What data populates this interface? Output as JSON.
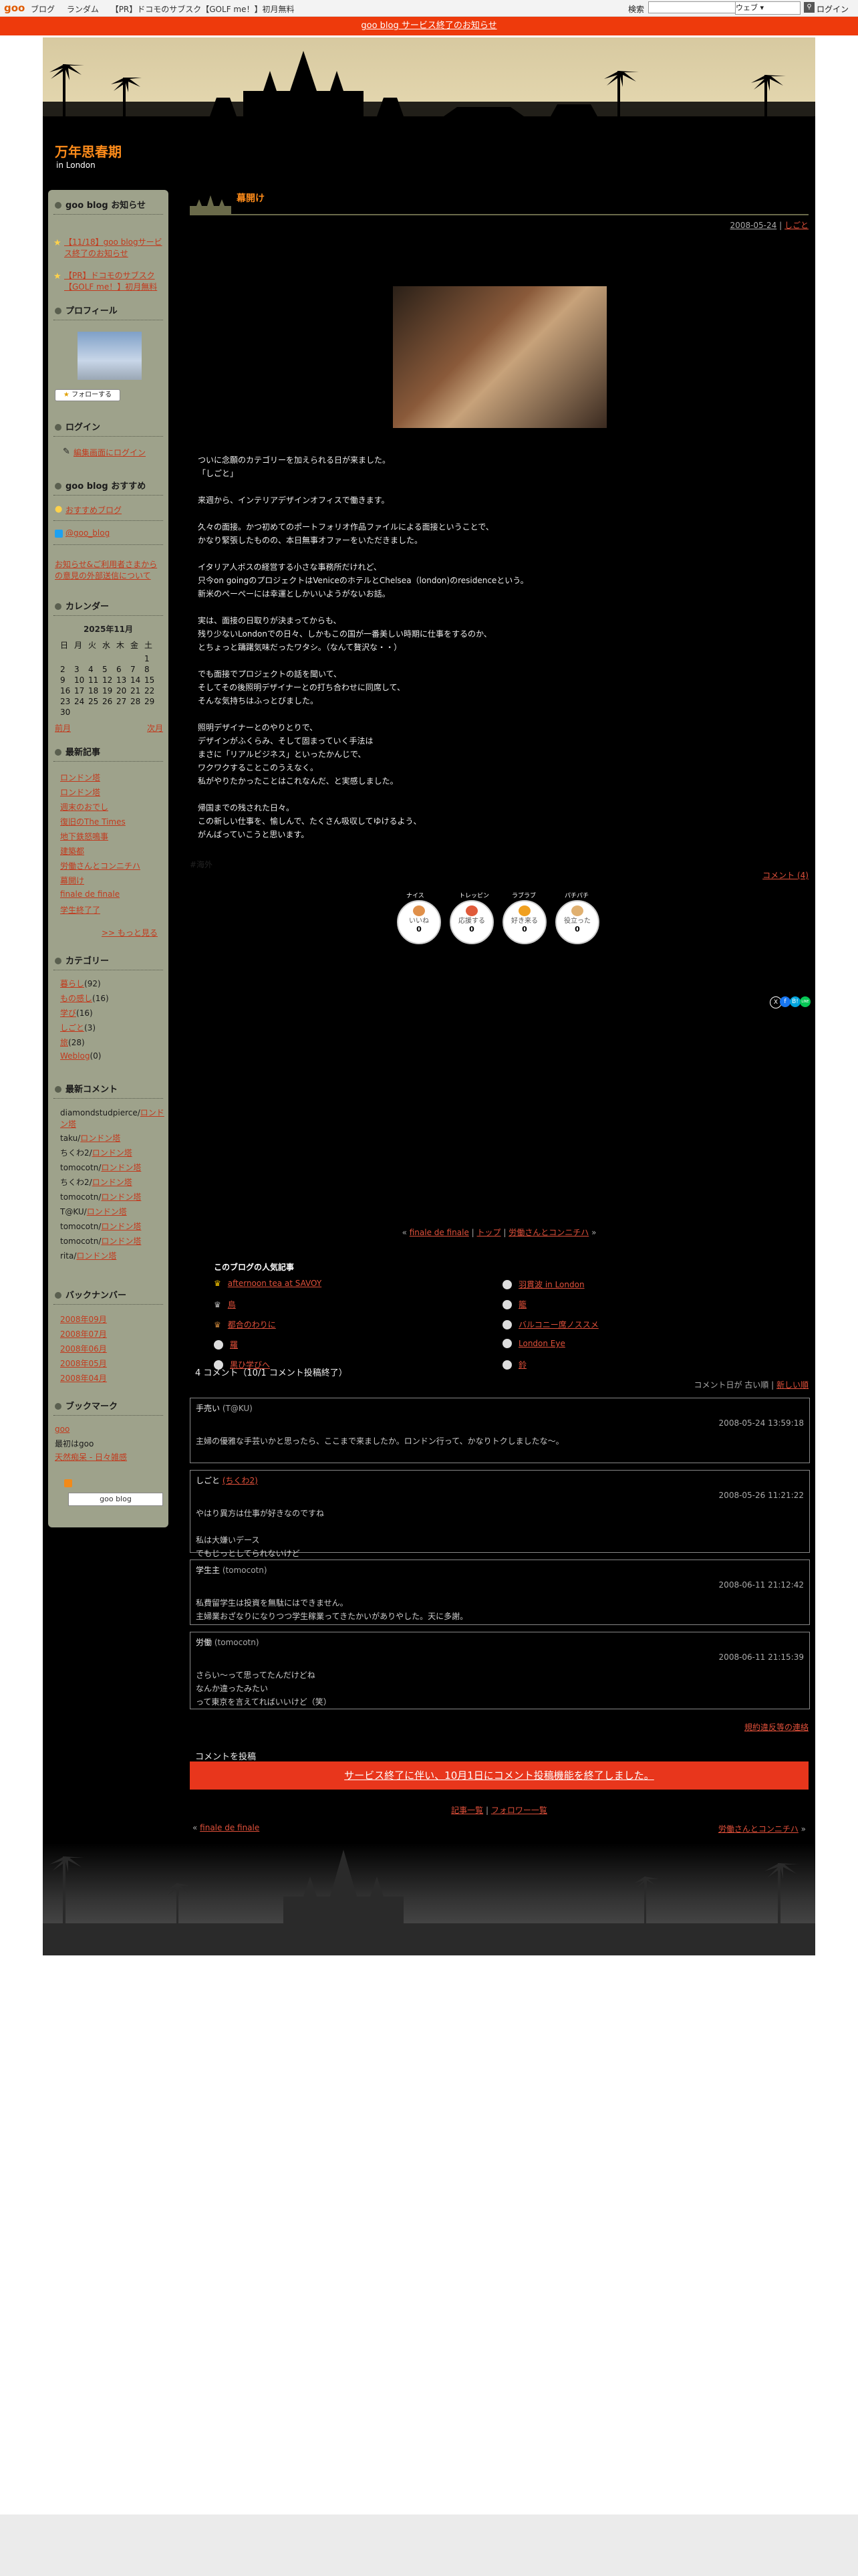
{
  "topbar": {
    "logo": "goo",
    "nav": [
      "ブログ",
      "ランダム",
      "【PR】ドコモのサブスク【GOLF me！】初月無料"
    ],
    "search_label": "検索",
    "search_value": "",
    "search_scope": "ウェブ",
    "login": "ログイン"
  },
  "notice": "goo blog サービス終了のお知らせ",
  "blog": {
    "title": "万年思春期",
    "subtitle": "in London"
  },
  "sidebar": {
    "notice_heading": "goo blog お知らせ",
    "notices": [
      "【11/18】goo blogサービス終了のお知らせ",
      "【PR】ドコモのサブスク【GOLF me！】初月無料"
    ],
    "profile_heading": "プロフィール",
    "follow_label": "フォローする",
    "login_heading": "ログイン",
    "login_link": "編集画面にログイン",
    "recommend_heading": "goo blog おすすめ",
    "recommend_link": "おすすめブログ",
    "twitter_link": "@goo_blog",
    "policy_link": "お知らせ&ご利用者さまからの意見の外部送信について",
    "calendar_heading": "カレンダー",
    "calendar_month": "2025年11月",
    "calendar_weekdays": [
      "日",
      "月",
      "火",
      "水",
      "木",
      "金",
      "土"
    ],
    "calendar_rows": [
      [
        "",
        "",
        "",
        "",
        "",
        "",
        "1"
      ],
      [
        "2",
        "3",
        "4",
        "5",
        "6",
        "7",
        "8"
      ],
      [
        "9",
        "10",
        "11",
        "12",
        "13",
        "14",
        "15"
      ],
      [
        "16",
        "17",
        "18",
        "19",
        "20",
        "21",
        "22"
      ],
      [
        "23",
        "24",
        "25",
        "26",
        "27",
        "28",
        "29"
      ],
      [
        "30",
        "",
        "",
        "",
        "",
        "",
        ""
      ]
    ],
    "prev_month": "前月",
    "next_month": "次月",
    "recent_heading": "最新記事",
    "recent_posts": [
      "ロンドン塔",
      "ロンドン塔",
      "週末のおでし",
      "復旧のThe Times",
      "地下鉄怒鳴事",
      "建築都",
      "労働さんとコンニチハ",
      "幕開け",
      "finale de finale",
      "学生終了了"
    ],
    "more_link": ">> もっと見る",
    "category_heading": "カテゴリー",
    "categories": [
      {
        "name": "暮らし",
        "count": "(92)"
      },
      {
        "name": "もの感し",
        "count": "(16)"
      },
      {
        "name": "学び",
        "count": "(16)"
      },
      {
        "name": "しごと",
        "count": "(3)"
      },
      {
        "name": "旅",
        "count": "(28)"
      },
      {
        "name": "Weblog",
        "count": "(0)"
      }
    ],
    "comments_heading": "最新コメント",
    "comments": [
      {
        "who": "diamondstudpierce/",
        "link": "ロンドン塔"
      },
      {
        "who": "taku/",
        "link": "ロンドン塔"
      },
      {
        "who": "ちくわ2/",
        "link": "ロンドン塔"
      },
      {
        "who": "tomocotn/",
        "link": "ロンドン塔"
      },
      {
        "who": "ちくわ2/",
        "link": "ロンドン塔"
      },
      {
        "who": "tomocotn/",
        "link": "ロンドン塔"
      },
      {
        "who": "T@KU/",
        "link": "ロンドン塔"
      },
      {
        "who": "tomocotn/",
        "link": "ロンドン塔"
      },
      {
        "who": "tomocotn/",
        "link": "ロンドン塔"
      },
      {
        "who": "rita/",
        "link": "ロンドン塔"
      }
    ],
    "backnumber_heading": "バックナンバー",
    "backnumbers": [
      "2008年09月",
      "2008年07月",
      "2008年06月",
      "2008年05月",
      "2008年04月"
    ],
    "bookmark_heading": "ブックマーク",
    "bookmark_links": [
      "goo",
      "最初はgoo",
      "天然痴呆 - 日々雑感"
    ],
    "goo_blog_badge": "goo blog"
  },
  "entry": {
    "title": "幕開け",
    "date": "2008-05-24",
    "category": "しごと",
    "paragraphs": [
      [
        "ついに念願のカテゴリーを加えられる日が来ました。",
        "「しごと」"
      ],
      [
        "来週から、インテリアデザインオフィスで働きます。"
      ],
      [
        "久々の面接。かつ初めてのポートフォリオ作品ファイルによる面接ということで、",
        "かなり緊張したものの、本日無事オファーをいただきました。"
      ],
      [
        "イタリア人ボスの経営する小さな事務所だけれど、",
        "只今on goingのプロジェクトはVeniceのホテルとChelsea（london)のresidenceという。",
        "新米のぺーぺーには幸運としかいいようがないお話。"
      ],
      [
        "実は、面接の日取りが決まってからも、",
        "残り少ないLondonでの日々、しかもこの国が一番美しい時期に仕事をするのか、",
        "とちょっと躊躇気味だったワタシ。（なんて贅沢な・・）"
      ],
      [
        "でも面接でプロジェクトの話を聞いて、",
        "そしてその後照明デザイナーとの打ち合わせに同席して、",
        "そんな気持ちはふっとびました。"
      ],
      [
        "照明デザイナーとのやりとりで、",
        "デザインがふくらみ、そして固まっていく手法は",
        "まさに「リアルビジネス」といったかんじで、",
        "ワクワクすることこのうえなく。",
        "私がやりたかったことはこれなんだ、と実感しました。"
      ],
      [
        "帰国までの残された日々。",
        "この新しい仕事を、愉しんで、たくさん吸収してゆけるよう、",
        "がんばっていこうと思います。"
      ]
    ],
    "tag": "#海外",
    "comment_count_link": "コメント (4)",
    "reactions": [
      {
        "top": "ナイス",
        "label": "いいね",
        "count": "0"
      },
      {
        "top": "トレッピン",
        "label": "応援する",
        "count": "0"
      },
      {
        "top": "ラブラブ",
        "label": "好き来る",
        "count": "0"
      },
      {
        "top": "パチパチ",
        "label": "役立った",
        "count": "0"
      }
    ],
    "share_icons": [
      "X",
      "f",
      "B!",
      "LINE"
    ]
  },
  "pager": {
    "prev": "finale de finale",
    "top": "トップ",
    "next": "労働さんとコンニチハ"
  },
  "popular": {
    "heading": "このブログの人気記事",
    "left": [
      "afternoon tea at SAVOY",
      "鳥",
      "都合のわりに",
      "羅",
      "黒ひ学びへ"
    ],
    "right": [
      "羽貫波  in London",
      "籠",
      "バルコニー席ノススメ",
      "London Eye",
      "鈴"
    ]
  },
  "comments_section": {
    "heading": "4 コメント（10/1 コメント投稿終了）",
    "order_label": "コメント日が  古い順  |",
    "newest_link": "新しい順",
    "items": [
      {
        "name": "手売い",
        "by": "(T@KU)",
        "date": "2008-05-24 13:59:18",
        "lines": [
          "主婦の優雅な手芸いかと思ったら、ここまで来ましたか。ロンドン行って、かなりトクしましたな～。"
        ]
      },
      {
        "name": "しごと",
        "by": "(ちくわ2)",
        "date": "2008-05-26 11:21:22",
        "lines": [
          "やはり異方は仕事が好きなのですね",
          "",
          "私は大嫌いデース",
          "でもじっとしてられないけど"
        ]
      },
      {
        "name": "学生主",
        "by": "(tomocotn)",
        "date": "2008-06-11 21:12:42",
        "lines": [
          "私費留学生は投資を無駄にはできません。",
          "主婦業おざなりになりつつ学生稼業ってきたかいがありやした。天に多謝。"
        ]
      },
      {
        "name": "労働",
        "by": "(tomocotn)",
        "date": "2008-06-11 21:15:39",
        "lines": [
          "さらい〜って思ってたんだけどね",
          "なんか違ったみたい",
          "って東京を言えてればいいけど（笑）"
        ]
      }
    ],
    "report_link": "規約違反等の連絡",
    "post_heading": "コメントを投稿",
    "closed_notice": "サービス終了に伴い、10月1日にコメント投稿機能を終了しました。"
  },
  "footer_nav": {
    "articles": "記事一覧",
    "followers": "フォロワー一覧",
    "prev": "finale de finale",
    "next": "労働さんとコンニチハ"
  }
}
